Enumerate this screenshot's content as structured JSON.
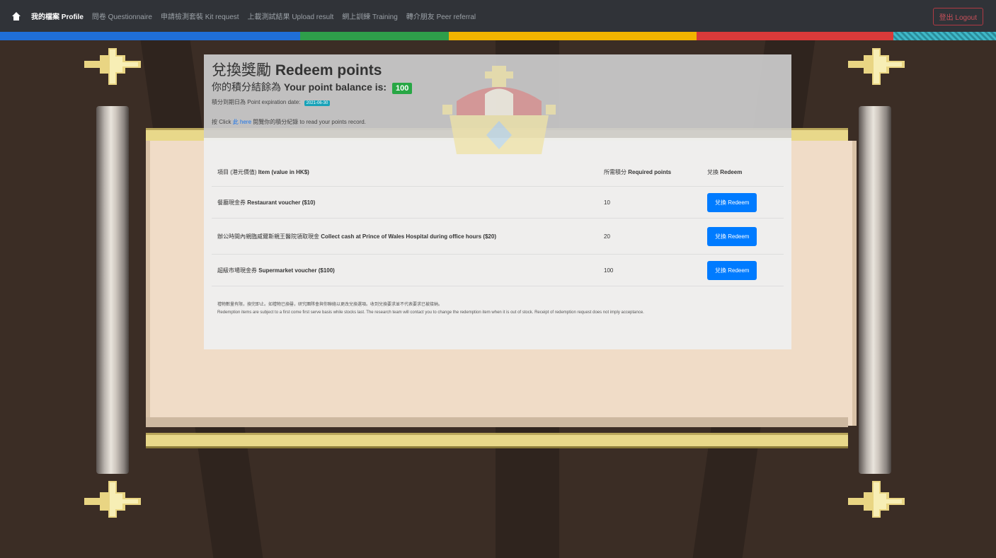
{
  "navbar": {
    "home_icon": "home-icon",
    "items": [
      {
        "label": "我的檔案 Profile",
        "active": true
      },
      {
        "label": "問卷 Questionnaire",
        "active": false
      },
      {
        "label": "申請檢測套裝 Kit request",
        "active": false
      },
      {
        "label": "上載測試結果 Upload result",
        "active": false
      },
      {
        "label": "網上訓練 Training",
        "active": false
      },
      {
        "label": "轉介朋友 Peer referral",
        "active": false
      }
    ],
    "logout_label": "登出 Logout",
    "stripe_colors": [
      "#1f6fd8",
      "#2e9e4a",
      "#f2b400",
      "#d93a3a"
    ]
  },
  "page": {
    "title_zh": "兌換獎勵",
    "title_en": "Redeem points",
    "balance_label_zh": "你的積分結餘為",
    "balance_label_en": "Your point balance is:",
    "balance_value": "100",
    "expiry_label": "積分到期日為 Point expiration date:",
    "expiry_value": "2021-06-30",
    "record_prefix": "按 Click",
    "record_link": "此 here",
    "record_suffix": "閱覽你的積分紀錄 to read your points record."
  },
  "table": {
    "headers": {
      "item_zh": "項目 (港元價值)",
      "item_en": "Item (value in HK$)",
      "points_zh": "所需積分",
      "points_en": "Required points",
      "redeem_zh": "兌換",
      "redeem_en": "Redeem"
    },
    "rows": [
      {
        "item_zh": "餐廳現金券",
        "item_en": "Restaurant voucher ($10)",
        "points": "10",
        "button": "兌換 Redeem"
      },
      {
        "item_zh": "辦公時間內親臨威爾斯親王醫院領取現金",
        "item_en": "Collect cash at Prince of Wales Hospital during office hours ($20)",
        "points": "20",
        "button": "兌換 Redeem"
      },
      {
        "item_zh": "超級市場現金券",
        "item_en": "Supermarket voucher ($100)",
        "points": "100",
        "button": "兌換 Redeem"
      }
    ]
  },
  "notes": {
    "zh": "禮物數量有限，換完即止。如禮物已換罄，研究團隊會與你聯絡以更改兌換選項。收到兌換要求並不代表要求已被接納。",
    "en": "Redemption items are subject to a first come first serve basis while stocks last. The research team will contact you to change the redemption item when it is out of stock. Receipt of redemption request does not imply acceptance."
  }
}
